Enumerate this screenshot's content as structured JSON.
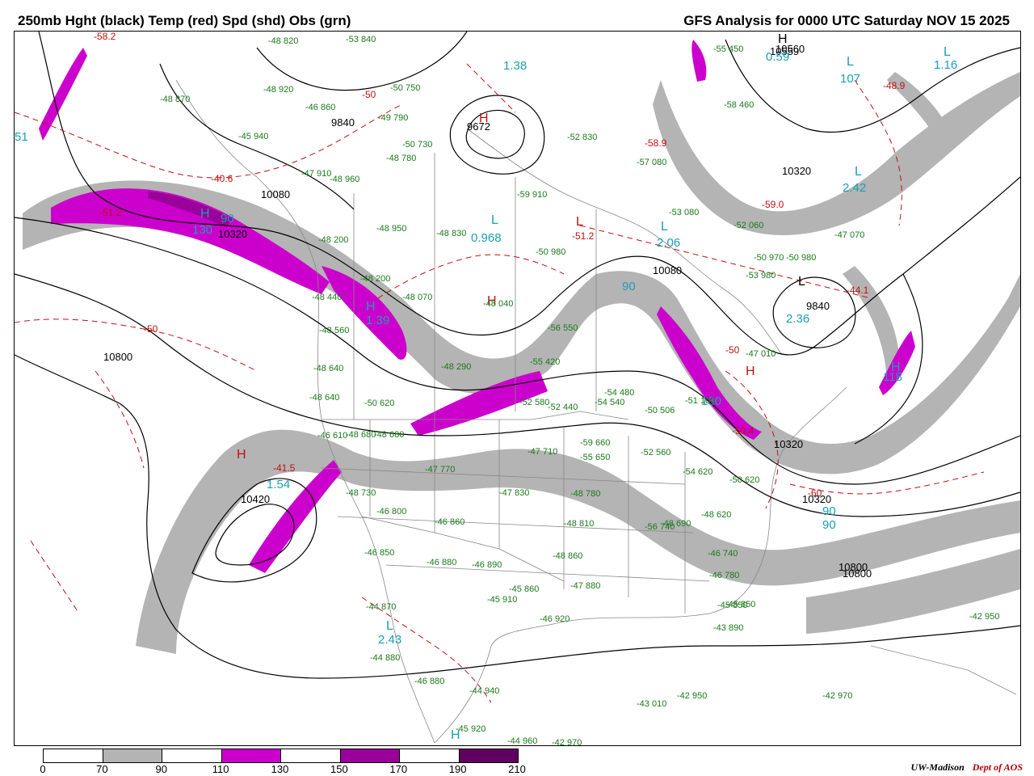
{
  "header": {
    "left_title": "250mb Hght (black) Temp (red) Spd (shd) Obs (grn)",
    "right_title": "GFS Analysis for 0000 UTC Saturday  NOV 15 2025"
  },
  "colors": {
    "height_contours": "#000000",
    "temperature_contours": "#c01010",
    "observations": "#1a7a1a",
    "speed_labels": "#1aa0b4",
    "speed_70_90": "#b4b4b4",
    "speed_110_130": "#cc00cc",
    "speed_130_150": "#9a009a",
    "speed_150_170": "#7a007a",
    "speed_170_190": "#600060",
    "speed_190_210": "#4a004a",
    "map_boundaries": "#888888"
  },
  "colorbar": {
    "ticks": [
      "0",
      "70",
      "90",
      "110",
      "130",
      "150",
      "170",
      "190",
      "210"
    ],
    "fills": [
      "#ffffff",
      "#b4b4b4",
      "#ffffff",
      "#cc00cc",
      "#ffffff",
      "#9a009a",
      "#ffffff",
      "#600060"
    ]
  },
  "credit": {
    "org": "UW-Madison",
    "dept": "Dept of AOS"
  },
  "height_labels": [
    "10320",
    "10080",
    "9840",
    "10320",
    "10080",
    "10800",
    "10420",
    "10320",
    "10560",
    "10800",
    "10320",
    "10800",
    "10559",
    "9840",
    "9672"
  ],
  "temperature_labels": [
    "-58.2",
    "-40.6",
    "-51.2",
    "-50",
    "-50",
    "-51.2",
    "-58.9",
    "-59.0",
    "-44.1",
    "-48.9",
    "-41.5",
    "-50",
    "-60",
    "-50.4"
  ],
  "speed_labels": [
    "130",
    "90",
    "1.38",
    "51",
    "1.16",
    "107",
    "2.42",
    "0.968",
    "2.06",
    "2.36",
    "90",
    "130",
    "1.39",
    "1.54",
    "118",
    "90",
    "90",
    "2.43",
    "0.59"
  ],
  "pressure_centers": [
    "H",
    "H",
    "H",
    "H",
    "H",
    "H",
    "H",
    "H",
    "H",
    "L",
    "L",
    "L",
    "L",
    "L",
    "L",
    "L",
    "L"
  ],
  "observations": [
    "-48 870",
    "-48 920",
    "-46 860",
    "-45 940",
    "-49 790",
    "-50 750",
    "-53 840",
    "-48 820",
    "-47 910",
    "-48 960",
    "-48 780",
    "-50 730",
    "-52 830",
    "-57 080",
    "-59 910",
    "-48 950",
    "-48 830",
    "-50 980",
    "-53 080",
    "-52 060",
    "-47 070",
    "-48 200",
    "-48 200",
    "-48 440",
    "-48 560",
    "-48 640",
    "-48 640",
    "-50 620",
    "-46 610",
    "-48 680",
    "-48 680",
    "-47 770",
    "-48 730",
    "-46 800",
    "-46 860",
    "-46 850",
    "-46 880",
    "-46 890",
    "-47 830",
    "-48 780",
    "-48 810",
    "-47 880",
    "-48 860",
    "-45 910",
    "-44 870",
    "-46 920",
    "-44 880",
    "-44 940",
    "-45 920",
    "-46 880",
    "-44 960",
    "-42 970",
    "-43 010",
    "-42 950",
    "-42 970",
    "-43 890",
    "-45 850",
    "-46 780",
    "-46 740",
    "-48 690",
    "-48 620",
    "-50 620",
    "-52 560",
    "-54 620",
    "-50 506",
    "-54 540",
    "-52 580",
    "-55 420",
    "-56 550",
    "-48 290",
    "-48 040",
    "-48 070",
    "-50 970",
    "-53 980",
    "-50 980",
    "-47 010",
    "-51 100",
    "-58 460",
    "-55 450",
    "-45 850",
    "-42 950",
    "-52 440",
    "-54 480",
    "-56 740",
    "-55 650",
    "-59 660",
    "-47 710",
    "-45 860"
  ]
}
